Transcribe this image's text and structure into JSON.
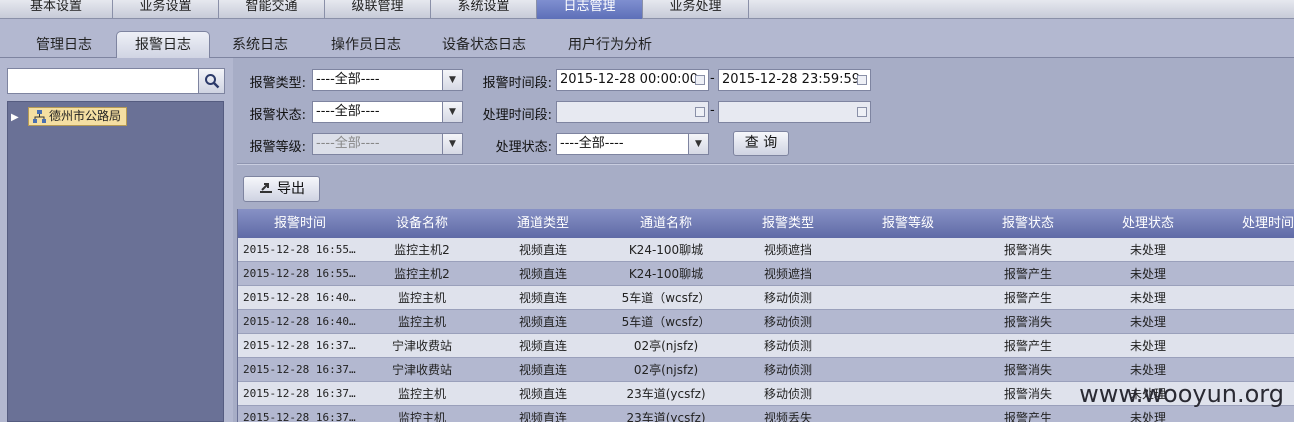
{
  "top_nav": [
    "基本设置",
    "业务设置",
    "智能交通",
    "级联管理",
    "系统设置",
    "日志管理",
    "业务处理"
  ],
  "top_nav_active": 5,
  "sub_tabs": [
    "管理日志",
    "报警日志",
    "系统日志",
    "操作员日志",
    "设备状态日志",
    "用户行为分析"
  ],
  "sub_tab_active": 1,
  "sidebar": {
    "search_value": "",
    "tree_root": "德州市公路局"
  },
  "filters": {
    "alarm_type_label": "报警类型:",
    "alarm_type_value": "----全部----",
    "alarm_status_label": "报警状态:",
    "alarm_status_value": "----全部----",
    "alarm_level_label": "报警等级:",
    "alarm_level_value": "----全部----",
    "alarm_period_label": "报警时间段:",
    "alarm_start": "2015-12-28 00:00:00",
    "alarm_end": "2015-12-28 23:59:59",
    "handle_period_label": "处理时间段:",
    "handle_start": "",
    "handle_end": "",
    "handle_status_label": "处理状态:",
    "handle_status_value": "----全部----",
    "dash": "-",
    "query_button": "查 询"
  },
  "export_button": "导出",
  "table": {
    "columns": [
      "报警时间",
      "设备名称",
      "通道类型",
      "通道名称",
      "报警类型",
      "报警等级",
      "报警状态",
      "处理状态",
      "处理时间"
    ],
    "rows": [
      [
        "2015-12-28 16:55…",
        "监控主机2",
        "视频直连",
        "K24-100聊城",
        "视频遮挡",
        "",
        "报警消失",
        "未处理",
        ""
      ],
      [
        "2015-12-28 16:55…",
        "监控主机2",
        "视频直连",
        "K24-100聊城",
        "视频遮挡",
        "",
        "报警产生",
        "未处理",
        ""
      ],
      [
        "2015-12-28 16:40…",
        "监控主机",
        "视频直连",
        "5车道（wcsfz）",
        "移动侦测",
        "",
        "报警产生",
        "未处理",
        ""
      ],
      [
        "2015-12-28 16:40…",
        "监控主机",
        "视频直连",
        "5车道（wcsfz）",
        "移动侦测",
        "",
        "报警消失",
        "未处理",
        ""
      ],
      [
        "2015-12-28 16:37…",
        "宁津收费站",
        "视频直连",
        "02亭(njsfz)",
        "移动侦测",
        "",
        "报警产生",
        "未处理",
        ""
      ],
      [
        "2015-12-28 16:37…",
        "宁津收费站",
        "视频直连",
        "02亭(njsfz)",
        "移动侦测",
        "",
        "报警消失",
        "未处理",
        ""
      ],
      [
        "2015-12-28 16:37…",
        "监控主机",
        "视频直连",
        "23车道(ycsfz)",
        "移动侦测",
        "",
        "报警消失",
        "未处理",
        ""
      ],
      [
        "2015-12-28 16:37…",
        "监控主机",
        "视频直连",
        "23车道(ycsfz)",
        "视频丢失",
        "",
        "报警产生",
        "未处理",
        ""
      ]
    ]
  },
  "watermark": "www.wooyun.org"
}
